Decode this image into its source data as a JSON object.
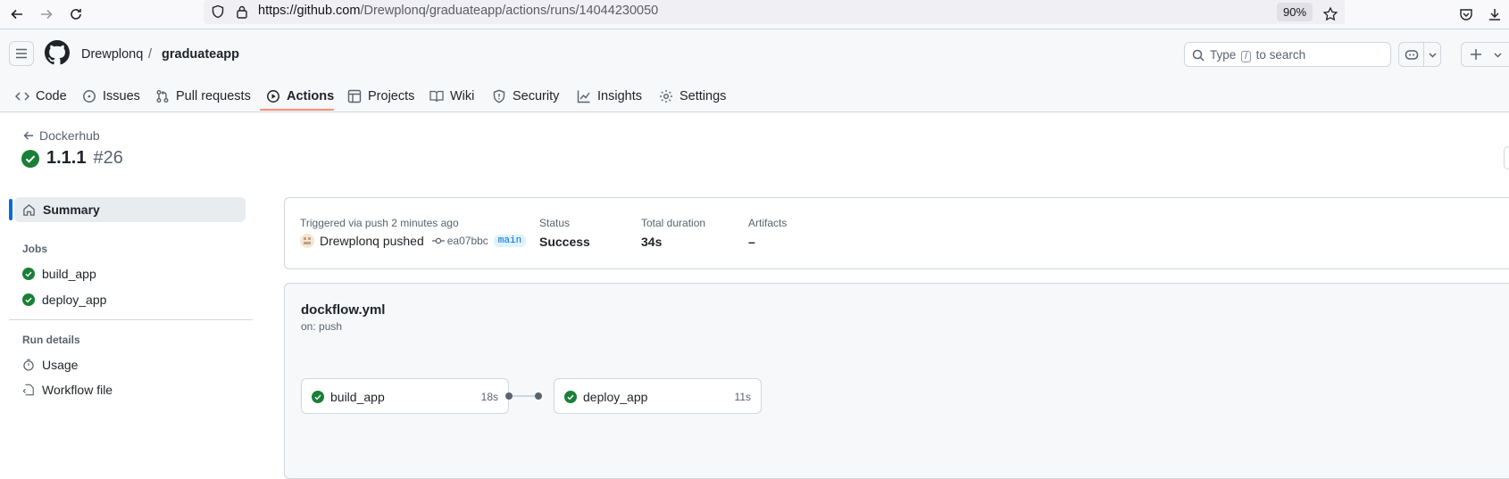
{
  "browser": {
    "url_host": "https://github.com",
    "url_path": "/Drewplonq/graduateapp/actions/runs/14044230050",
    "zoom": "90%"
  },
  "header": {
    "owner": "Drewplonq",
    "separator": "/",
    "repo": "graduateapp",
    "search_prefix": "Type",
    "search_key": "/",
    "search_suffix": "to search"
  },
  "tabs": [
    {
      "label": "Code",
      "icon": "code-icon"
    },
    {
      "label": "Issues",
      "icon": "issue-icon"
    },
    {
      "label": "Pull requests",
      "icon": "pull-request-icon"
    },
    {
      "label": "Actions",
      "icon": "play-icon",
      "active": true
    },
    {
      "label": "Projects",
      "icon": "table-icon"
    },
    {
      "label": "Wiki",
      "icon": "book-icon"
    },
    {
      "label": "Security",
      "icon": "shield-icon"
    },
    {
      "label": "Insights",
      "icon": "graph-icon"
    },
    {
      "label": "Settings",
      "icon": "gear-icon"
    }
  ],
  "run": {
    "back_label": "Dockerhub",
    "version": "1.1.1",
    "number": "#26"
  },
  "sidebar": {
    "summary": "Summary",
    "jobs_heading": "Jobs",
    "jobs": [
      "build_app",
      "deploy_app"
    ],
    "run_details_heading": "Run details",
    "usage": "Usage",
    "workflow_file": "Workflow file"
  },
  "summary": {
    "triggered": "Triggered via push 2 minutes ago",
    "actor": "Drewplonq pushed",
    "sha": "ea07bbc",
    "branch": "main",
    "status_label": "Status",
    "status": "Success",
    "duration_label": "Total duration",
    "duration": "34s",
    "artifacts_label": "Artifacts",
    "artifacts": "–"
  },
  "workflow": {
    "name": "dockflow.yml",
    "trigger": "on: push",
    "jobs": [
      {
        "name": "build_app",
        "duration": "18s"
      },
      {
        "name": "deploy_app",
        "duration": "11s"
      }
    ]
  },
  "colors": {
    "success": "#1a7f37",
    "accent": "#fd8c73",
    "link": "#0969da"
  }
}
